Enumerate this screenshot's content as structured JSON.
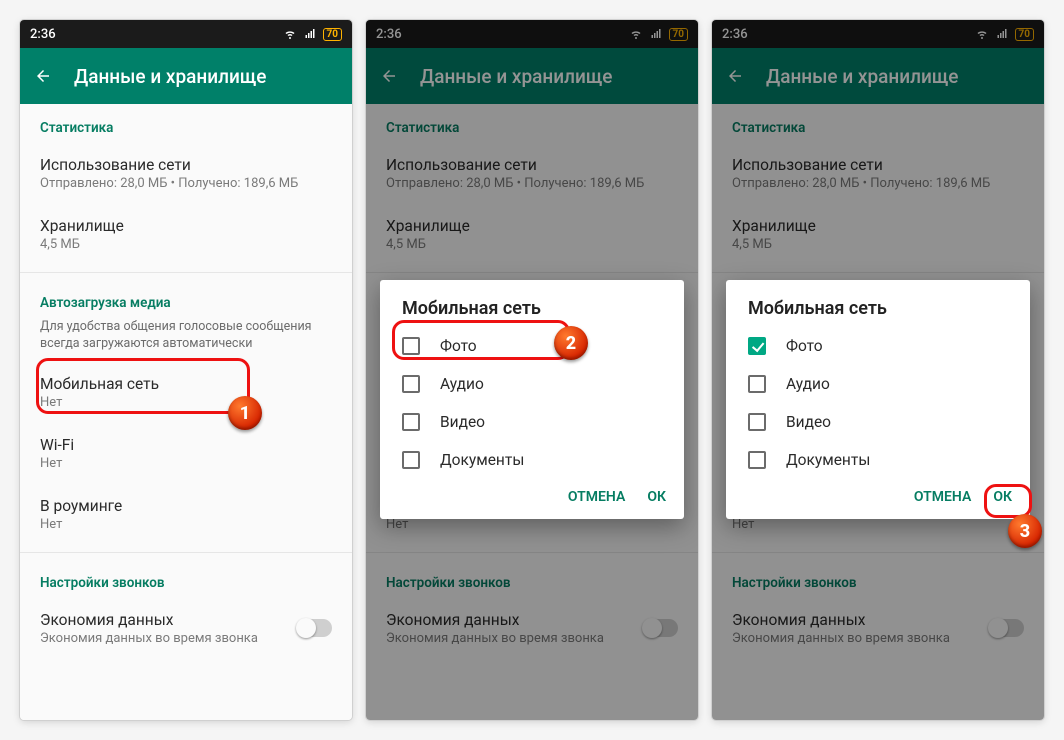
{
  "status": {
    "time": "2:36",
    "battery": "70"
  },
  "appbar": {
    "title": "Данные и хранилище"
  },
  "sections": {
    "stats": {
      "header": "Статистика",
      "net": {
        "title": "Использование сети",
        "sub": "Отправлено: 28,0 МБ • Получено: 189,6 МБ"
      },
      "storage": {
        "title": "Хранилище",
        "sub": "4,5 МБ"
      }
    },
    "autodl": {
      "header": "Автозагрузка медиа",
      "sub": "Для удобства общения голосовые сообщения всегда загружаются автоматически",
      "mobile": {
        "title": "Мобильная сеть",
        "sub": "Нет"
      },
      "wifi": {
        "title": "Wi-Fi",
        "sub": "Нет"
      },
      "roaming": {
        "title": "В роуминге",
        "sub": "Нет"
      }
    },
    "calls": {
      "header": "Настройки звонков",
      "saver": {
        "title": "Экономия данных",
        "sub": "Экономия данных во время звонка"
      }
    }
  },
  "dialog": {
    "title": "Мобильная сеть",
    "options": {
      "photo": "Фото",
      "audio": "Аудио",
      "video": "Видео",
      "docs": "Документы"
    },
    "cancel": "ОТМЕНА",
    "ok": "ОК"
  },
  "badges": {
    "b1": "1",
    "b2": "2",
    "b3": "3"
  }
}
